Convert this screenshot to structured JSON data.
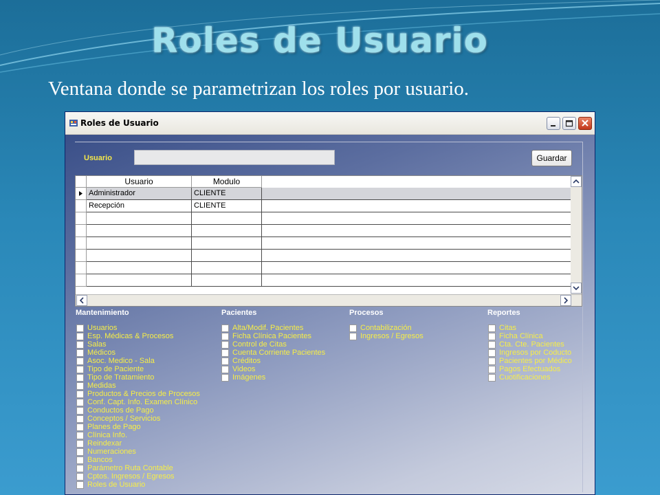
{
  "slide": {
    "title": "Roles de Usuario",
    "subtitle": "Ventana donde se parametrizan los roles por usuario."
  },
  "window": {
    "title": "Roles de Usuario",
    "icon": "app-icon",
    "buttons": [
      "minimize-icon",
      "maximize-icon",
      "close-icon"
    ]
  },
  "form": {
    "usuario_label": "Usuario",
    "usuario_value": "",
    "save_label": "Guardar"
  },
  "grid": {
    "columns": [
      "Usuario",
      "Modulo"
    ],
    "rows": [
      {
        "usuario": "Administrador",
        "modulo": "CLIENTE",
        "selected": true
      },
      {
        "usuario": "Recepción",
        "modulo": "CLIENTE",
        "selected": false
      },
      {
        "usuario": "",
        "modulo": "",
        "selected": false
      },
      {
        "usuario": "",
        "modulo": "",
        "selected": false
      },
      {
        "usuario": "",
        "modulo": "",
        "selected": false
      },
      {
        "usuario": "",
        "modulo": "",
        "selected": false
      },
      {
        "usuario": "",
        "modulo": "",
        "selected": false
      },
      {
        "usuario": "",
        "modulo": "",
        "selected": false
      }
    ]
  },
  "sections": [
    {
      "title": "Mantenimiento",
      "items": [
        "Usuarios",
        "Esp. Médicas & Procesos",
        "Salas",
        "Médicos",
        "Asoc. Medico - Sala",
        "Tipo de Paciente",
        "Tipo de Tratamiento",
        "Medidas",
        "Productos & Precios de Procesos",
        "Conf. Capt. Info. Examen Clínico",
        "Conductos de Pago",
        "Conceptos / Servicios",
        "Planes de Pago",
        "Clínica Info.",
        "Reindexar",
        "Numeraciones",
        "Bancos",
        "Parámetro Ruta Contable",
        "Cptos. Ingresos / Egresos",
        "Roles de Usuario"
      ]
    },
    {
      "title": "Pacientes",
      "items": [
        "Alta/Modif. Pacientes",
        "Ficha Clínica Pacientes",
        "Control de Citas",
        "Cuenta Corriente Pacientes",
        "Créditos",
        "Videos",
        "Imágenes"
      ]
    },
    {
      "title": "Procesos",
      "items": [
        "Contabilización",
        "Ingresos / Egresos"
      ]
    },
    {
      "title": "Reportes",
      "items": [
        "Citas",
        "Ficha Clínica",
        "Cta. Cte. Pacientes",
        "Ingresos por Coducto",
        "Pacientes por Médico",
        "Pagos Efectuados",
        "Cuotificaciones"
      ]
    }
  ],
  "colors": {
    "label_yellow": "#f5e84a",
    "slide_title": "#9fe0ec",
    "background": "#2a88b8"
  }
}
